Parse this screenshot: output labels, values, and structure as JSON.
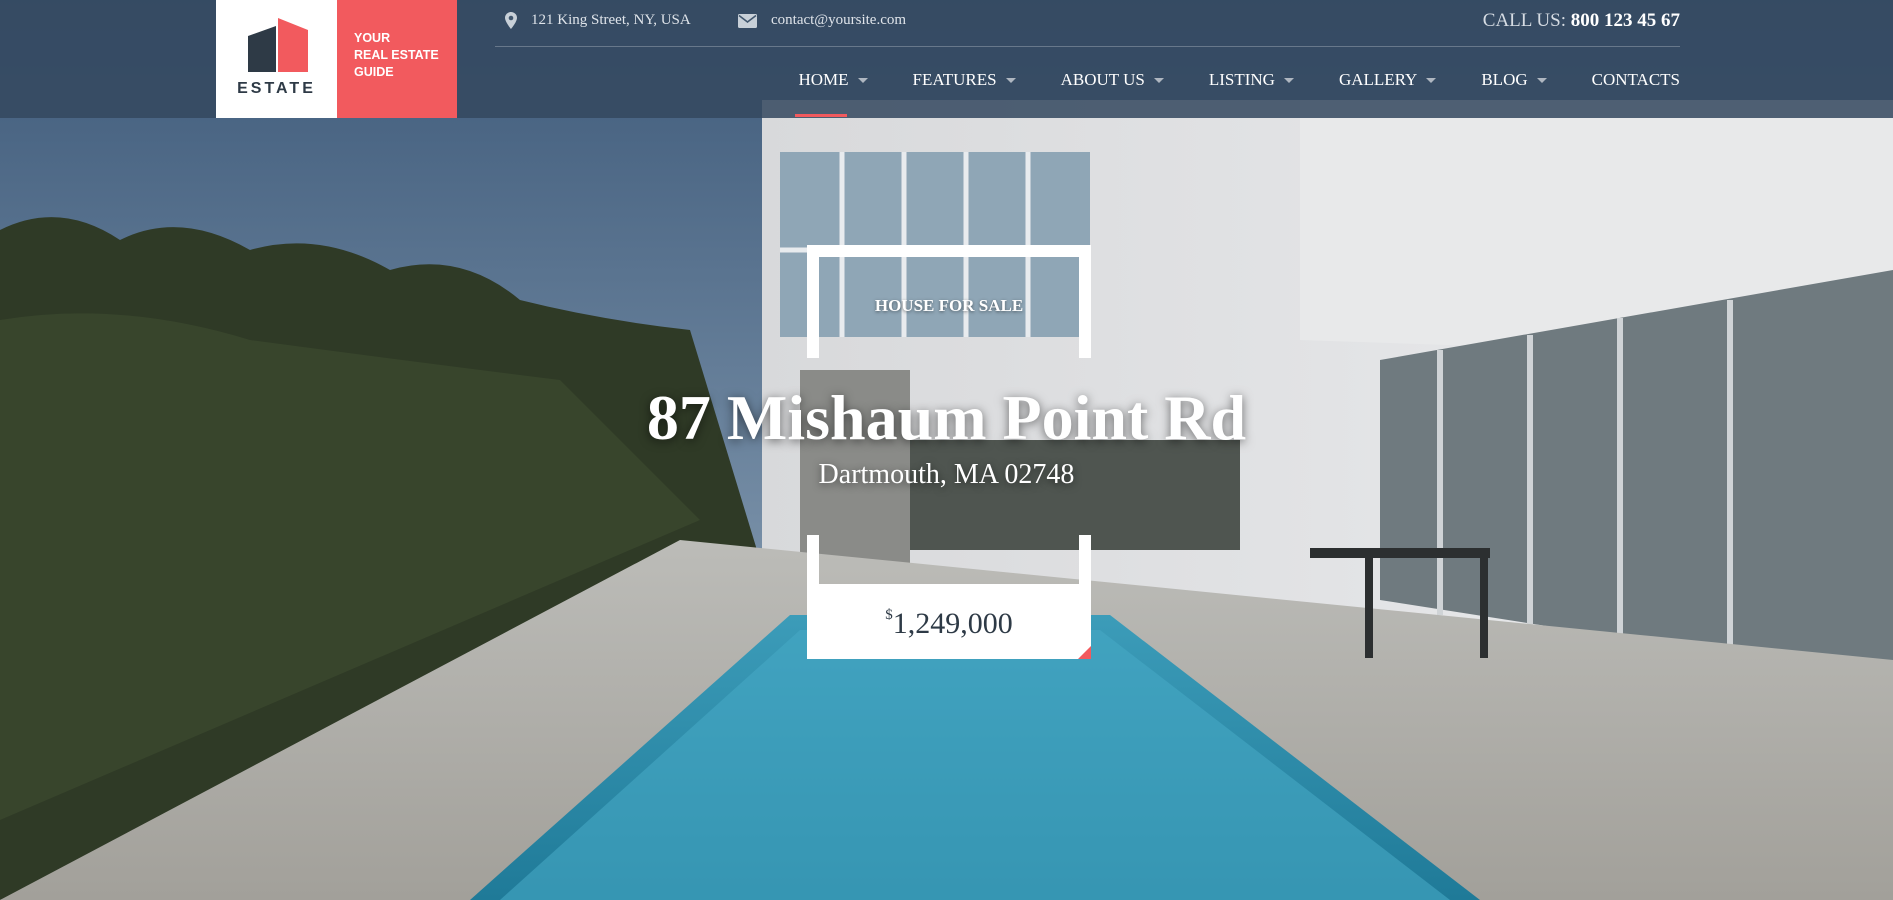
{
  "logo": {
    "wordmark": "ESTATE",
    "tagline": [
      "YOUR",
      "REAL ESTATE",
      "GUIDE"
    ]
  },
  "topbar": {
    "address": "121 King Street, NY, USA",
    "email": "contact@yoursite.com",
    "call_label": "CALL US:",
    "call_number": "800 123 45 67"
  },
  "nav": {
    "items": [
      {
        "label": "HOME",
        "active": true,
        "has_dropdown": true
      },
      {
        "label": "FEATURES",
        "has_dropdown": true
      },
      {
        "label": "ABOUT US",
        "has_dropdown": true
      },
      {
        "label": "LISTING",
        "has_dropdown": true
      },
      {
        "label": "GALLERY",
        "has_dropdown": true
      },
      {
        "label": "BLOG",
        "has_dropdown": true
      },
      {
        "label": "CONTACTS",
        "has_dropdown": false
      }
    ]
  },
  "hero": {
    "badge": "HOUSE FOR SALE",
    "address": "87 Mishaum Point Rd",
    "city": "Dartmouth, MA 02748",
    "currency": "$",
    "price": "1,249,000"
  },
  "colors": {
    "accent": "#f25a5e",
    "header_bg": "#344860",
    "text_dark": "#2e3a46"
  },
  "icons": {
    "address": "map-pin-icon",
    "email": "envelope-icon",
    "dropdown": "caret-down-icon"
  }
}
